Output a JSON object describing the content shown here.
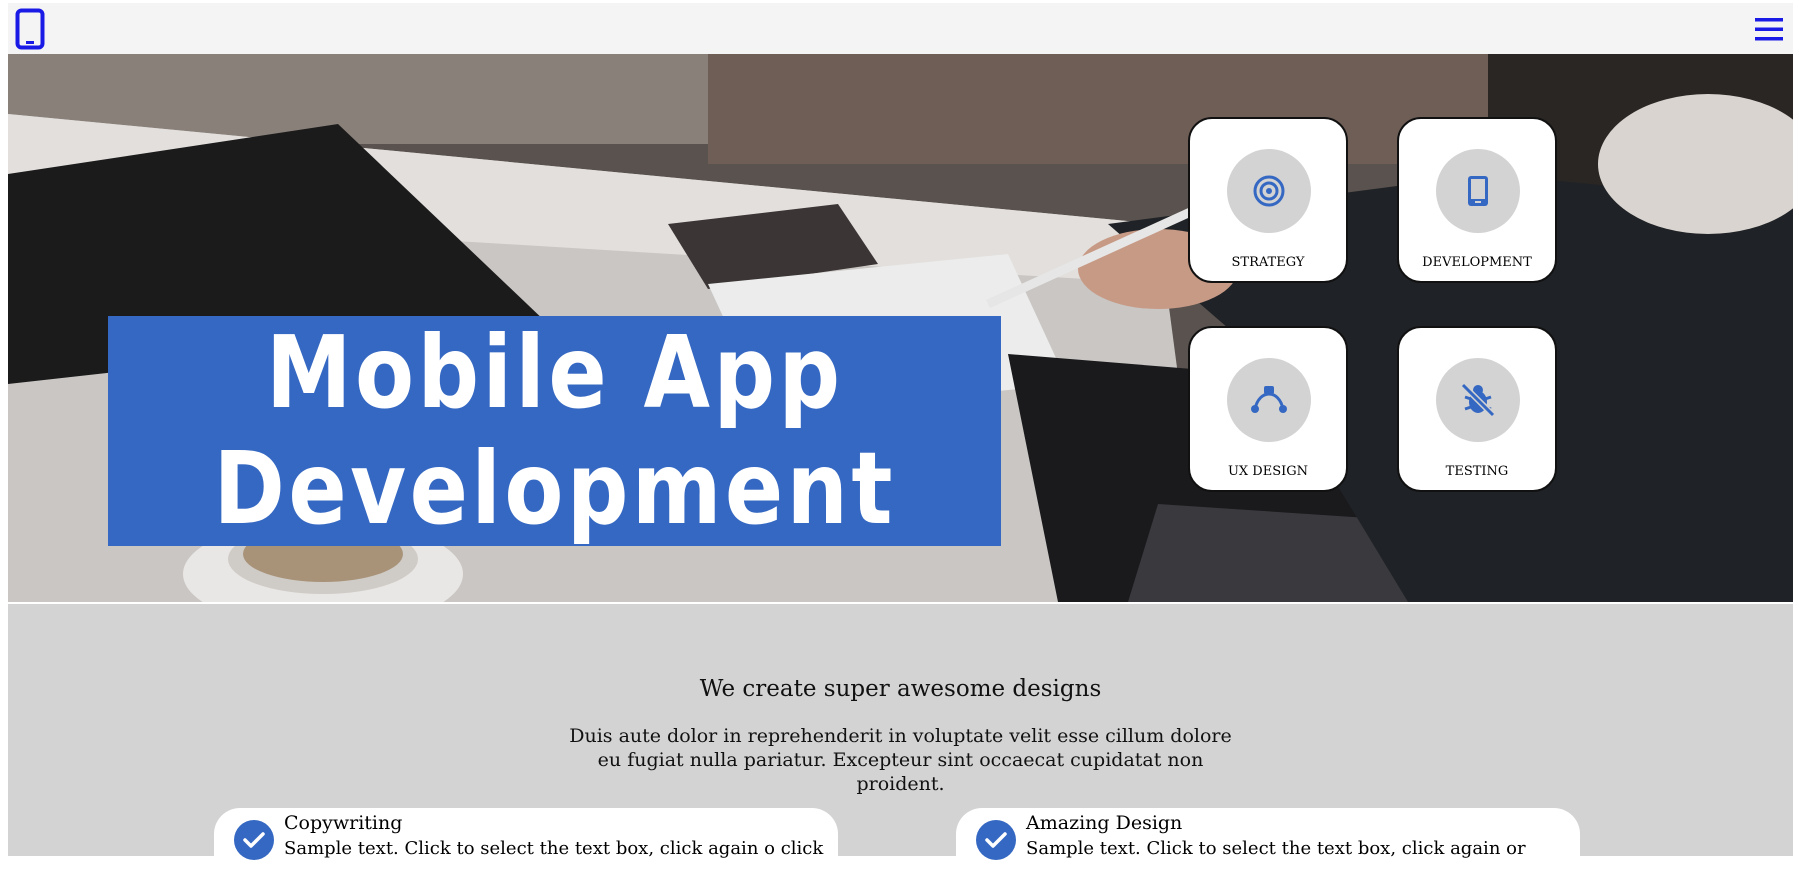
{
  "header": {
    "logo_icon": "mobile-phone-icon",
    "menu_icon": "hamburger-menu-icon",
    "logo_color": "#1a1ae6",
    "menu_color": "#1a1ae6"
  },
  "hero": {
    "title_line1": "Mobile App",
    "title_line2": "Development",
    "title_bg": "#3568c2",
    "cards": [
      {
        "label": "STRATEGY",
        "icon": "target-icon"
      },
      {
        "label": "DEVELOPMENT",
        "icon": "smartphone-icon"
      },
      {
        "label": "UX DESIGN",
        "icon": "bezier-curve-icon"
      },
      {
        "label": "TESTING",
        "icon": "bug-off-icon"
      }
    ]
  },
  "about": {
    "headline": "We create super awesome designs",
    "paragraph": "Duis aute dolor in reprehenderit in voluptate velit esse cillum dolore eu fugiat nulla pariatur. Excepteur sint occaecat cupidatat non proident.",
    "features": [
      {
        "title": "Copywriting",
        "text": "Sample text. Click to select the text box, click again o click",
        "icon": "check-circle-icon"
      },
      {
        "title": "Amazing Design",
        "text": "Sample text. Click to select the text box, click again or",
        "icon": "check-circle-icon"
      }
    ],
    "accent": "#3568c2",
    "background": "#d3d3d3"
  }
}
